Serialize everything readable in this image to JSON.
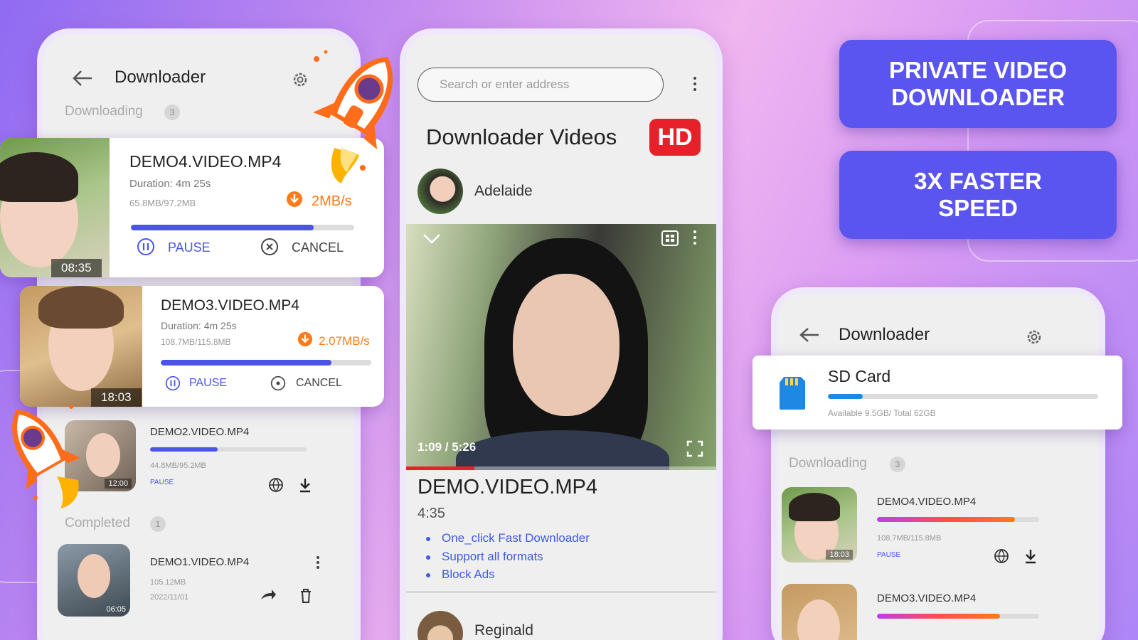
{
  "promo": {
    "line1": "PRIVATE VIDEO DOWNLOADER",
    "line2": "3X FASTER SPEED"
  },
  "left_phone": {
    "title": "Downloader",
    "downloading_label": "Downloading",
    "downloading_count": "3",
    "items": [
      {
        "name": "DEMO4.VIDEO.MP4",
        "duration": "Duration: 4m 25s",
        "size": "65.8MB/97.2MB",
        "speed": "2MB/s",
        "time": "08:35",
        "pause": "PAUSE",
        "cancel": "CANCEL",
        "progress": 0.82
      },
      {
        "name": "DEMO3.VIDEO.MP4",
        "duration": "Duration: 4m 25s",
        "size": "108.7MB/115.8MB",
        "speed": "2.07MB/s",
        "time": "18:03",
        "pause": "PAUSE",
        "cancel": "CANCEL",
        "progress": 0.81
      },
      {
        "name": "DEMO2.VIDEO.MP4",
        "size": "44.8MB/95.2MB",
        "status": "PAUSE",
        "time": "12:00",
        "progress": 0.43
      }
    ],
    "completed_label": "Completed",
    "completed_count": "1",
    "completed": [
      {
        "name": "DEMO1.VIDEO.MP4",
        "size": "105.12MB",
        "date": "2022/11/01",
        "time": "06:05"
      }
    ]
  },
  "center_phone": {
    "search_placeholder": "Search or enter address",
    "heading": "Downloader Videos",
    "hd_badge": "HD",
    "channel": "Adelaide",
    "player_time": "1:09 / 5:26",
    "player_progress": 0.22,
    "video_title": "DEMO.VIDEO.MP4",
    "video_length": "4:35",
    "features": [
      "One_click Fast Downloader",
      "Support all formats",
      "Block Ads"
    ],
    "next_channel": "Reginald"
  },
  "right_phone": {
    "title": "Downloader",
    "storage_label": "SD Card",
    "storage_info": "Available 9.5GB/ Total 62GB",
    "storage_used": 0.13,
    "downloading_label": "Downloading",
    "downloading_count": "3",
    "items": [
      {
        "name": "DEMO4.VIDEO.MP4",
        "size": "108.7MB/115.8MB",
        "status": "PAUSE",
        "time": "18:03",
        "progress": 0.85
      },
      {
        "name": "DEMO3.VIDEO.MP4",
        "progress": 0.76
      }
    ]
  },
  "colors": {
    "accent": "#4a55e8",
    "promo": "#5b55ef",
    "orange": "#ff7a1a",
    "hd_red": "#e8202a",
    "gradient_bar": "#d43cf0"
  }
}
